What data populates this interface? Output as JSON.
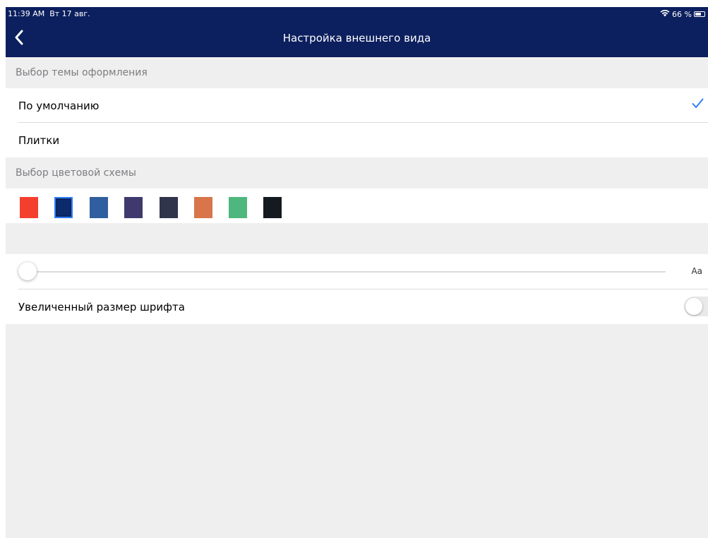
{
  "status_bar": {
    "time": "11:39 AM",
    "date": "Вт 17 авг.",
    "battery_text": "66 %",
    "battery_level": 0.66
  },
  "nav": {
    "title": "Настройка внешнего вида",
    "back_icon": "chevron-left-icon"
  },
  "theme_section": {
    "header": "Выбор темы оформления",
    "options": [
      {
        "label": "По умолчанию",
        "selected": true
      },
      {
        "label": "Плитки",
        "selected": false
      }
    ]
  },
  "color_section": {
    "header": "Выбор цветовой схемы",
    "swatches": [
      {
        "color": "#f43f2f",
        "selected": false
      },
      {
        "color": "#0c2a6c",
        "selected": true
      },
      {
        "color": "#2f5f9e",
        "selected": false
      },
      {
        "color": "#3f3a6e",
        "selected": false
      },
      {
        "color": "#30354b",
        "selected": false
      },
      {
        "color": "#d9754a",
        "selected": false
      },
      {
        "color": "#4eb77e",
        "selected": false
      },
      {
        "color": "#151a21",
        "selected": false
      }
    ]
  },
  "font_section": {
    "slider_value": 0,
    "slider_label": "Aa",
    "toggle_label": "Увеличенный размер шрифта",
    "toggle_on": false
  },
  "colors": {
    "header_bg": "#0c1f5e",
    "accent": "#2f7ef7",
    "background": "#efefef"
  }
}
